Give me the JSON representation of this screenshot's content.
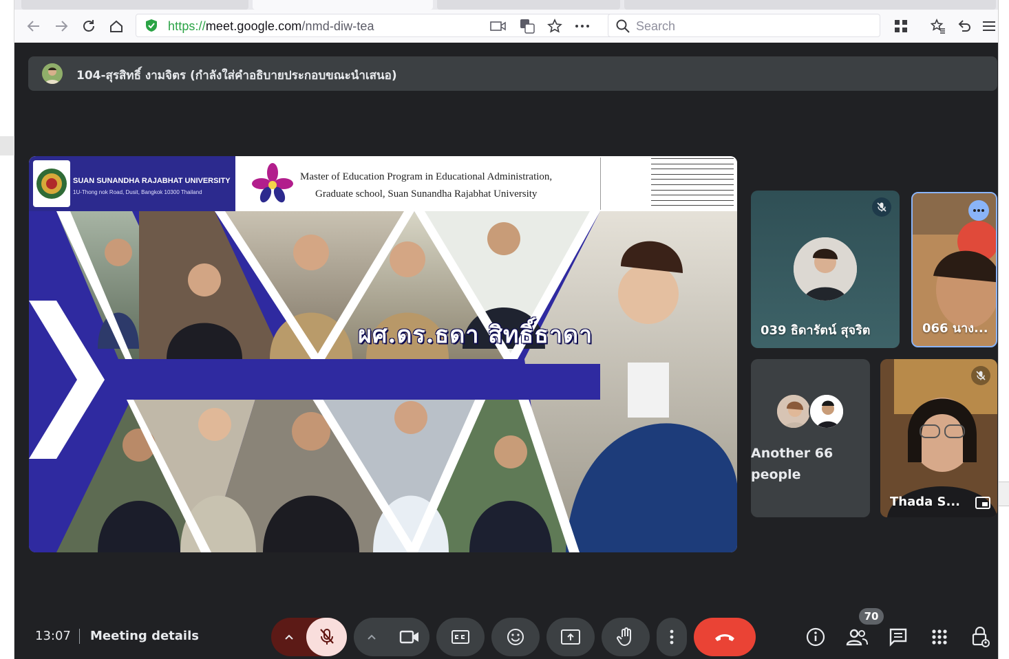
{
  "browser": {
    "url_scheme": "https://",
    "url_host": "meet.google.com",
    "url_path": "/nmd-diw-tea",
    "search_placeholder": "Search"
  },
  "presenter": {
    "text": "104-สุรสิทธิ์ งามจิตร (กำลังใส่คำอธิบายประกอบขณะนำเสนอ)"
  },
  "slide": {
    "university_name": "SUAN SUNANDHA RAJABHAT UNIVERSITY",
    "university_address": "1U-Thong nok Road, Dusit, Bangkok 10300 Thailand",
    "program_line1": "Master of Education Program in Educational Administration,",
    "program_line2": "Graduate school, Suan Sunandha Rajabhat University",
    "title": "ผศ.ดร.ธดา  สิทธิ์ธาดา"
  },
  "participants": [
    {
      "name": "039 ธิดารัตน์ สุจริต",
      "muted": true
    },
    {
      "name": "066 นาง...",
      "muted": false
    },
    {
      "name": "Another 66 people"
    },
    {
      "name": "Thada S...",
      "muted": true
    }
  ],
  "controls": {
    "time": "13:07",
    "meeting_details": "Meeting details",
    "people_count": "70"
  },
  "colors": {
    "meet_bg": "#202124",
    "control_bg": "#3c4043",
    "mic_muted_red": "#f9dedc",
    "mic_group_dark": "#5c1a16",
    "hangup_red": "#ea4335",
    "slide_blue": "#2f2aa0"
  }
}
